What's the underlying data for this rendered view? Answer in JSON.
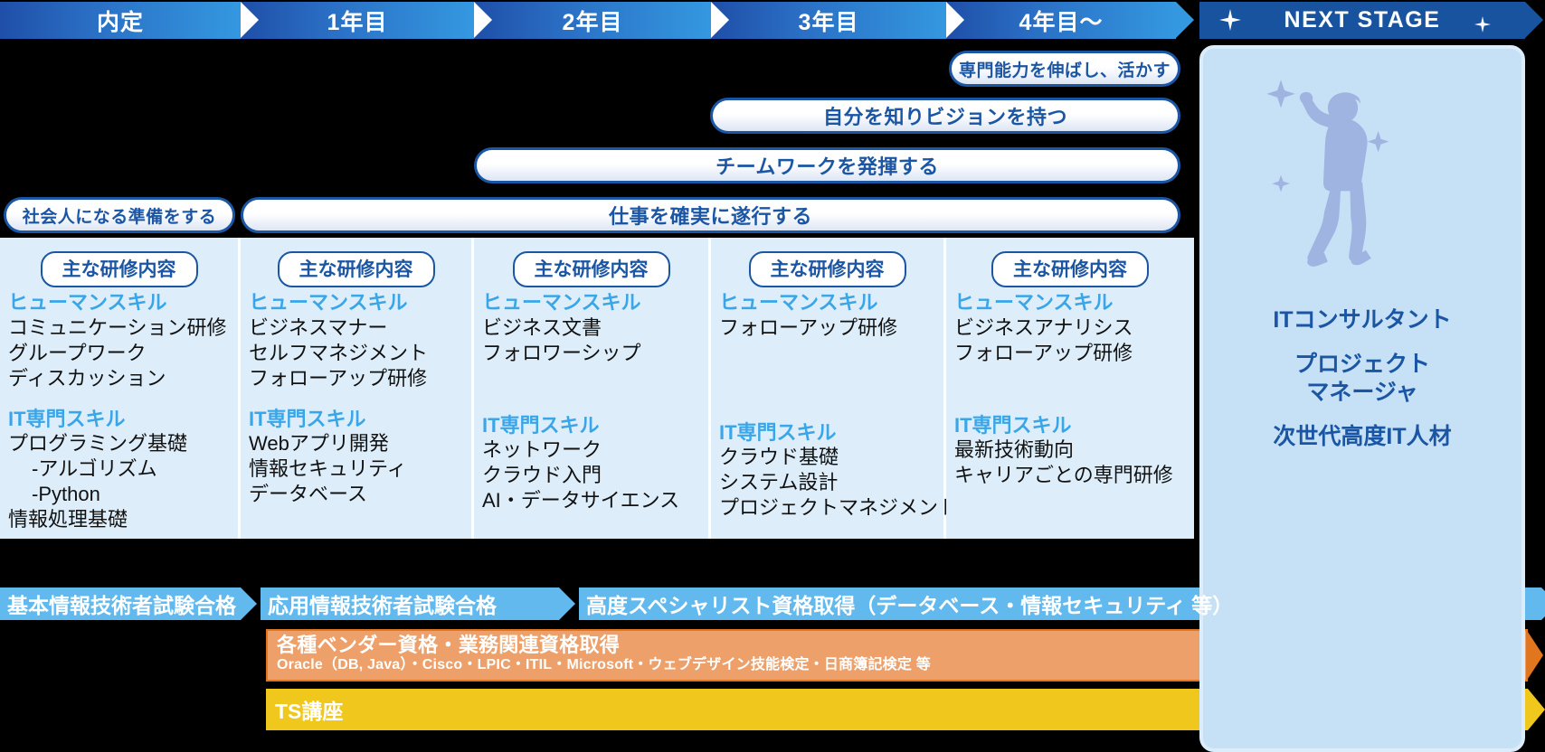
{
  "timeline": {
    "stages": [
      {
        "label": "内定"
      },
      {
        "label": "1年目"
      },
      {
        "label": "2年目"
      },
      {
        "label": "3年目"
      },
      {
        "label": "4年目～"
      }
    ],
    "next_stage_label": "NEXT STAGE"
  },
  "goals": [
    {
      "label": "専門能力を伸ばし、活かす"
    },
    {
      "label": "自分を知りビジョンを持つ"
    },
    {
      "label": "チームワークを発揮する"
    },
    {
      "label": "社会人になる準備をする"
    },
    {
      "label": "仕事を確実に遂行する"
    }
  ],
  "columns": [
    {
      "tag": "主な研修内容",
      "human_label": "ヒューマンスキル",
      "human_items": [
        "コミュニケーション研修",
        "グループワーク",
        "ディスカッション"
      ],
      "it_label": "IT専門スキル",
      "it_items": [
        "プログラミング基礎",
        "-アルゴリズム",
        "-Python",
        "情報処理基礎"
      ],
      "it_indent": [
        false,
        true,
        true,
        false
      ]
    },
    {
      "tag": "主な研修内容",
      "human_label": "ヒューマンスキル",
      "human_items": [
        "ビジネスマナー",
        "セルフマネジメント",
        "フォローアップ研修"
      ],
      "it_label": "IT専門スキル",
      "it_items": [
        "Webアプリ開発",
        "情報セキュリティ",
        "データベース"
      ],
      "it_indent": [
        false,
        false,
        false
      ]
    },
    {
      "tag": "主な研修内容",
      "human_label": "ヒューマンスキル",
      "human_items": [
        "ビジネス文書",
        "フォロワーシップ"
      ],
      "it_label": "IT専門スキル",
      "it_items": [
        "ネットワーク",
        "クラウド入門",
        "AI・データサイエンス"
      ],
      "it_indent": [
        false,
        false,
        false
      ]
    },
    {
      "tag": "主な研修内容",
      "human_label": "ヒューマンスキル",
      "human_items": [
        "フォローアップ研修"
      ],
      "it_label": "IT専門スキル",
      "it_items": [
        "クラウド基礎",
        "システム設計",
        "プロジェクトマネジメント"
      ],
      "it_indent": [
        false,
        false,
        false
      ]
    },
    {
      "tag": "主な研修内容",
      "human_label": "ヒューマンスキル",
      "human_items": [
        "ビジネスアナリシス",
        "フォローアップ研修"
      ],
      "it_label": "IT専門スキル",
      "it_items": [
        "最新技術動向",
        "キャリアごとの専門研修"
      ],
      "it_indent": [
        false,
        false
      ]
    }
  ],
  "certifications": [
    {
      "label": "基本情報技術者試験合格"
    },
    {
      "label": "応用情報技術者試験合格"
    },
    {
      "label": "高度スペシャリスト資格取得（データベース・情報セキュリティ 等）"
    }
  ],
  "vendor_bar": {
    "title": "各種ベンダー資格・業務関連資格取得",
    "subtitle": "Oracle（DB, Java）・Cisco・LPIC・ITIL・Microsoft・ウェブデザイン技能検定・日商簿記検定 等"
  },
  "ts_bar": {
    "label": "TS講座"
  },
  "next_stage_card": {
    "roles": [
      "ITコンサルタント",
      "プロジェクト\nマネージャ",
      "次世代高度IT人材"
    ],
    "role1": "ITコンサルタント",
    "role2_line1": "プロジェクト",
    "role2_line2": "マネージャ",
    "role3": "次世代高度IT人材"
  },
  "colors": {
    "header_dark": "#1f4fa8",
    "header_light": "#3498e0",
    "next_stage": "#18539f",
    "pill_border": "#1b56a4",
    "column_bg": "#ddeefa",
    "accent_cyan": "#3aa6e8",
    "cert_blue": "#62b9ee",
    "vendor_orange": "#eda06a",
    "vendor_border": "#e2761e",
    "ts_yellow": "#f0c71c",
    "card_bg": "#c6e0f5",
    "figure": "#9fb4e0"
  }
}
